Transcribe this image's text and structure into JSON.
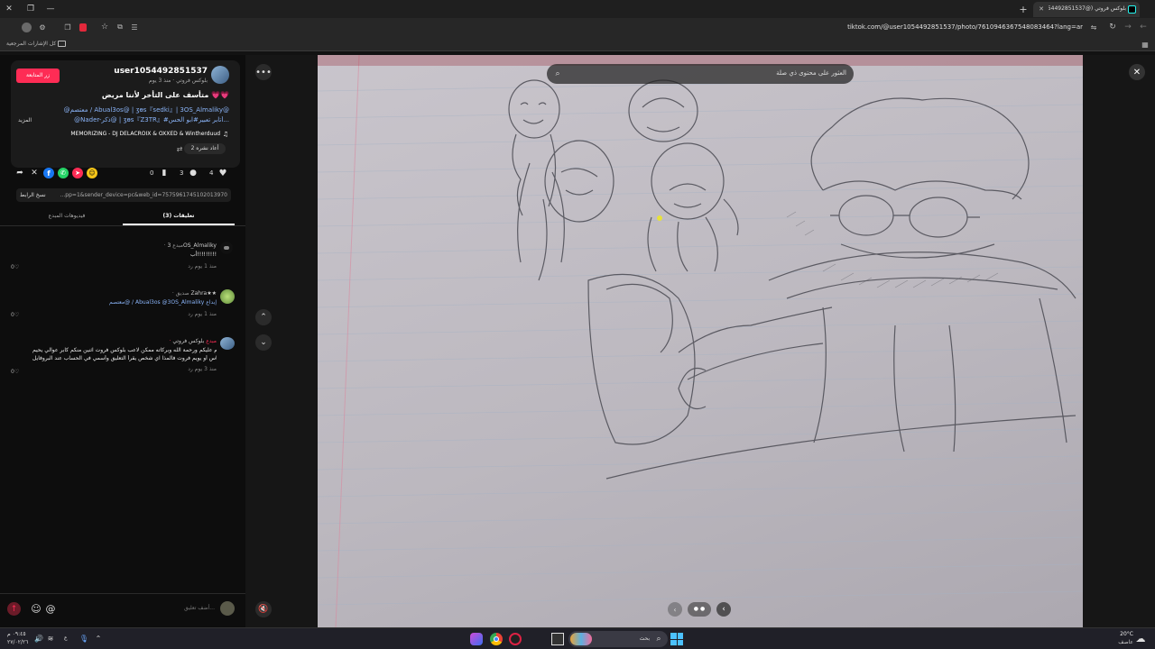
{
  "browser": {
    "tab_title": "بلوكس فروتي (@user1054492851537",
    "url": "tiktok.com/@user1054492851537/photo/7610946367548083464?lang=ar",
    "bookmarks_label": "كل الإشارات المرجعية"
  },
  "post": {
    "username": "user1054492851537",
    "display_meta": "بلوكس فروتي · منذ 3 يوم",
    "follow_label": "زر المتابعة",
    "caption": "متأسف على التأخر لأننا مريض 💗💗",
    "mentions_line1": "@معتصم / Abual3os@ | ʒɵs『sedki』| 3OS_Almaliky@",
    "mentions_line2": "@Nader-ذكر@ | ʒɵs『Z3TR』#أتابر تعبير#ابو الحس...",
    "more_label": "المزيد",
    "music": "MEMORIZING - DJ DELACROIX & OXXED & Wintherduud",
    "replay": "أعاد نشره 2",
    "likes": "4",
    "comments_count": "3",
    "saves": "0",
    "link_text": "...pp=1&sender_device=pc&web_id=7575961745102013970",
    "copy_link": "نسخ الرابط",
    "tab_comments": "تعليقات (3)",
    "tab_videos": "فيديوهات المبدع"
  },
  "comments": [
    {
      "author": "3OS_Almaliky",
      "badge": "· مبدع",
      "text": "أب!!!!!!!!!",
      "meta": "منذ 1 يوم   رد",
      "likes": "0"
    },
    {
      "author": "Zahra★★",
      "badge": "· صديق",
      "text": "معتصم@ / Abual3os @3OS_Almaliky إبداع",
      "meta": "منذ 1 يوم   رد",
      "likes": "0"
    },
    {
      "author": "بلوكس فروتي",
      "badge": "· مبدع",
      "text": "السلام عليكم ورحمة الله وبركاته ممكن لاعب بلوكس فروت اثنين منكم كابر عوالي يحيم",
      "text2": "ياس أو يويم فروت فالمذا اي شخص يقرأ التعليق وأسمي في الحساب عند البروفايل",
      "meta": "منذ 3 يوم   رد",
      "likes": "0"
    }
  ],
  "comment_input_placeholder": "أضف تعليق...",
  "search": {
    "placeholder": "العثور على محتوى ذي صلة"
  },
  "photo_pager": "● ●",
  "weather": {
    "temp": "20°C",
    "cond": "عاصف"
  },
  "taskbar_search": "بحث",
  "clock": {
    "time": "٠٩:٤٥ م",
    "date": "٢٧/٠٢/٢٦"
  },
  "tray_lang": "ع"
}
